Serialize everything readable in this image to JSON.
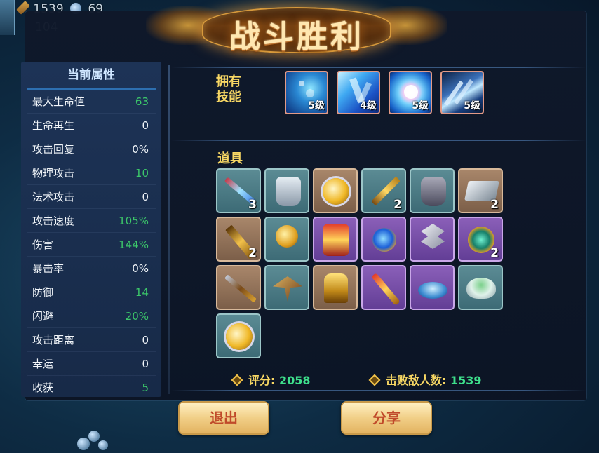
{
  "hud": {
    "kills": "1539",
    "orbs": "69",
    "gold": "104"
  },
  "title": "战斗胜利",
  "attributes": {
    "header": "当前属性",
    "rows": [
      {
        "label": "最大生命值",
        "value": "63",
        "color": "green"
      },
      {
        "label": "生命再生",
        "value": "0",
        "color": "white"
      },
      {
        "label": "攻击回复",
        "value": "0%",
        "color": "white"
      },
      {
        "label": "物理攻击",
        "value": "10",
        "color": "green"
      },
      {
        "label": "法术攻击",
        "value": "0",
        "color": "white"
      },
      {
        "label": "攻击速度",
        "value": "105%",
        "color": "green"
      },
      {
        "label": "伤害",
        "value": "144%",
        "color": "green"
      },
      {
        "label": "暴击率",
        "value": "0%",
        "color": "white"
      },
      {
        "label": "防御",
        "value": "14",
        "color": "green"
      },
      {
        "label": "闪避",
        "value": "20%",
        "color": "green"
      },
      {
        "label": "攻击距离",
        "value": "0",
        "color": "white"
      },
      {
        "label": "幸运",
        "value": "0",
        "color": "white"
      },
      {
        "label": "收获",
        "value": "5",
        "color": "green"
      }
    ]
  },
  "skills": {
    "label": "拥有技能",
    "list": [
      {
        "icon": "water-bubble-skill-icon",
        "level": "5级"
      },
      {
        "icon": "ice-crystal-skill-icon",
        "level": "4级"
      },
      {
        "icon": "light-orb-skill-icon",
        "level": "5级"
      },
      {
        "icon": "blade-spikes-skill-icon",
        "level": "5级"
      }
    ]
  },
  "items": {
    "label": "道具",
    "list": [
      {
        "icon": "blue-sword-icon",
        "bg": "teal",
        "count": "3"
      },
      {
        "icon": "silver-armor-icon",
        "bg": "teal",
        "count": ""
      },
      {
        "icon": "gold-orb-ring-icon",
        "bg": "tan",
        "count": ""
      },
      {
        "icon": "golden-sword-icon",
        "bg": "teal",
        "count": "2"
      },
      {
        "icon": "dark-chestplate-icon",
        "bg": "teal",
        "count": ""
      },
      {
        "icon": "iron-block-icon",
        "bg": "tan",
        "count": "2"
      },
      {
        "icon": "golden-greatsword-icon",
        "bg": "tan",
        "count": "2"
      },
      {
        "icon": "gold-coins-icon",
        "bg": "teal",
        "count": ""
      },
      {
        "icon": "red-gold-armor-icon",
        "bg": "purple",
        "count": ""
      },
      {
        "icon": "blue-gem-amulet-icon",
        "bg": "purple",
        "count": ""
      },
      {
        "icon": "battle-axe-icon",
        "bg": "purple",
        "count": ""
      },
      {
        "icon": "jade-medallion-icon",
        "bg": "purple",
        "count": "2"
      },
      {
        "icon": "ornate-spear-icon",
        "bg": "tan",
        "count": ""
      },
      {
        "icon": "crossbow-icon",
        "bg": "teal",
        "count": ""
      },
      {
        "icon": "golden-idol-icon",
        "bg": "tan",
        "count": ""
      },
      {
        "icon": "golden-staff-icon",
        "bg": "purple",
        "count": ""
      },
      {
        "icon": "water-splash-icon",
        "bg": "purple",
        "count": ""
      },
      {
        "icon": "herbal-bowl-icon",
        "bg": "teal",
        "count": ""
      },
      {
        "icon": "gold-orb-ring-icon",
        "bg": "teal",
        "count": ""
      }
    ]
  },
  "stats": {
    "score_label": "评分:",
    "score_value": "2058",
    "kills_label": "击败敌人数:",
    "kills_value": "1539"
  },
  "buttons": {
    "exit": "退出",
    "share": "分享"
  },
  "colors": {
    "label_gold": "#f7d764",
    "value_green": "#3ee08c",
    "button_text": "#c04a2a"
  }
}
